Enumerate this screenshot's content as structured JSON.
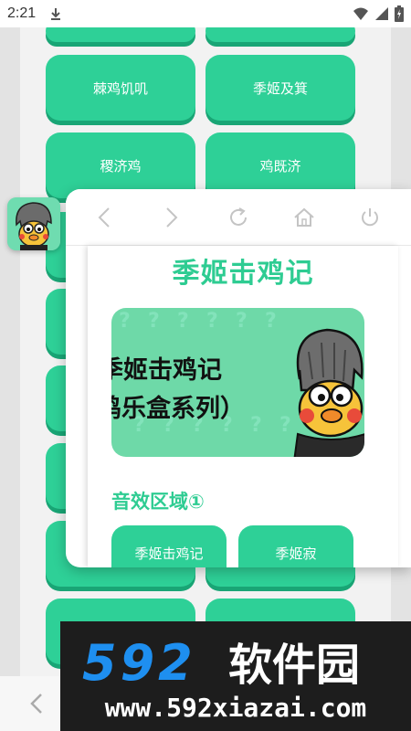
{
  "status_bar": {
    "time": "2:21"
  },
  "background_grid": {
    "buttons": [
      "棘鸡饥叽",
      "季姬及箕",
      "稷济鸡",
      "鸡既济"
    ]
  },
  "toolbar": {
    "icons": [
      "back-icon",
      "forward-icon",
      "refresh-icon",
      "home-icon",
      "power-icon"
    ]
  },
  "page": {
    "title": "季姬击鸡记",
    "banner_line1": "季姬击鸡记",
    "banner_line2": "鸡乐盒系列）",
    "section_title": "音效区域①",
    "sound_buttons": [
      "季姬击鸡记",
      "季姬寂"
    ]
  },
  "watermark": {
    "logo_text": "592软件园",
    "url": "www.592xiazai.com"
  },
  "colors": {
    "accent": "#2ed097",
    "accent_shadow": "#19a575",
    "title_green": "#2ecc92"
  }
}
